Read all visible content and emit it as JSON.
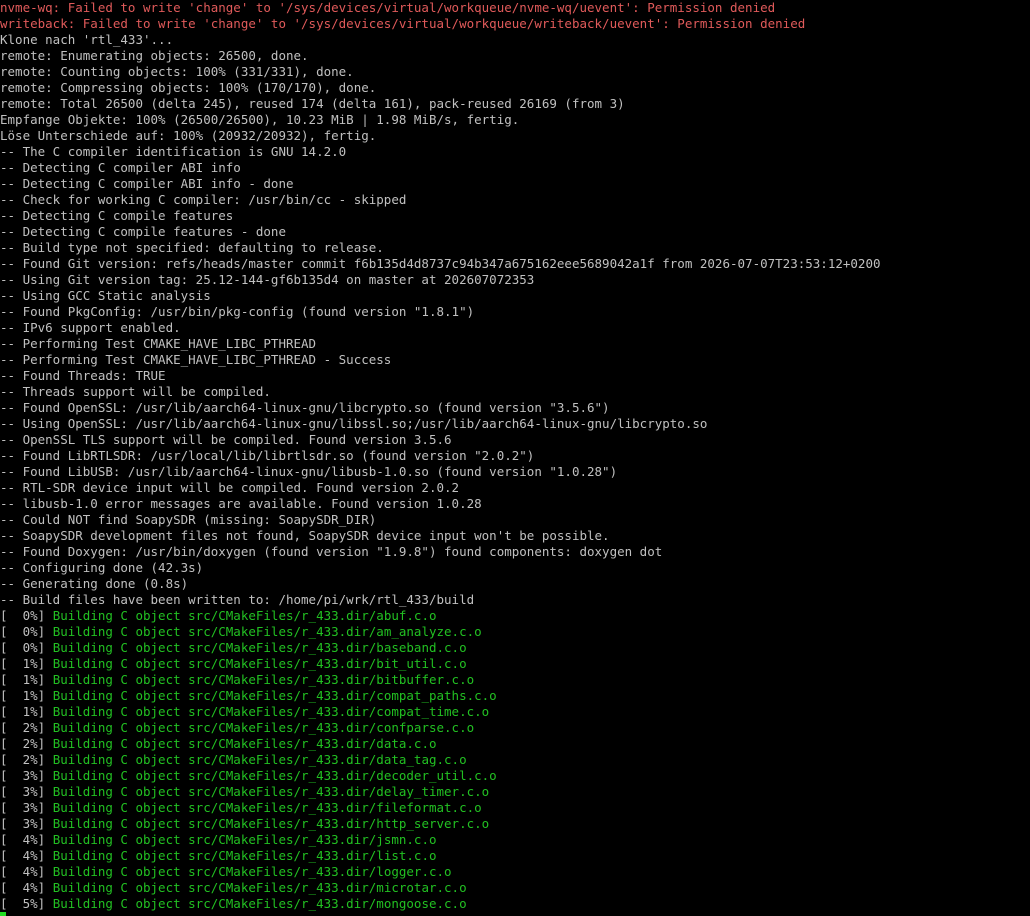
{
  "terminal": {
    "colors": {
      "background": "#000000",
      "foreground": "#c0c0c0",
      "error": "#e05a5a",
      "progress": "#22c022",
      "cursor": "#22dd22"
    },
    "lines": [
      {
        "type": "error",
        "text": "nvme-wq: Failed to write 'change' to '/sys/devices/virtual/workqueue/nvme-wq/uevent': Permission denied"
      },
      {
        "type": "error",
        "text": "writeback: Failed to write 'change' to '/sys/devices/virtual/workqueue/writeback/uevent': Permission denied"
      },
      {
        "type": "normal",
        "text": "Klone nach 'rtl_433'..."
      },
      {
        "type": "normal",
        "text": "remote: Enumerating objects: 26500, done."
      },
      {
        "type": "normal",
        "text": "remote: Counting objects: 100% (331/331), done."
      },
      {
        "type": "normal",
        "text": "remote: Compressing objects: 100% (170/170), done."
      },
      {
        "type": "normal",
        "text": "remote: Total 26500 (delta 245), reused 174 (delta 161), pack-reused 26169 (from 3)"
      },
      {
        "type": "normal",
        "text": "Empfange Objekte: 100% (26500/26500), 10.23 MiB | 1.98 MiB/s, fertig."
      },
      {
        "type": "normal",
        "text": "Löse Unterschiede auf: 100% (20932/20932), fertig."
      },
      {
        "type": "normal",
        "text": "-- The C compiler identification is GNU 14.2.0"
      },
      {
        "type": "normal",
        "text": "-- Detecting C compiler ABI info"
      },
      {
        "type": "normal",
        "text": "-- Detecting C compiler ABI info - done"
      },
      {
        "type": "normal",
        "text": "-- Check for working C compiler: /usr/bin/cc - skipped"
      },
      {
        "type": "normal",
        "text": "-- Detecting C compile features"
      },
      {
        "type": "normal",
        "text": "-- Detecting C compile features - done"
      },
      {
        "type": "normal",
        "text": "-- Build type not specified: defaulting to release."
      },
      {
        "type": "normal",
        "text": "-- Found Git version: refs/heads/master commit f6b135d4d8737c94b347a675162eee5689042a1f from 2026-07-07T23:53:12+0200"
      },
      {
        "type": "normal",
        "text": "-- Using Git version tag: 25.12-144-gf6b135d4 on master at 202607072353"
      },
      {
        "type": "normal",
        "text": "-- Using GCC Static analysis"
      },
      {
        "type": "normal",
        "text": "-- Found PkgConfig: /usr/bin/pkg-config (found version \"1.8.1\")"
      },
      {
        "type": "normal",
        "text": "-- IPv6 support enabled."
      },
      {
        "type": "normal",
        "text": "-- Performing Test CMAKE_HAVE_LIBC_PTHREAD"
      },
      {
        "type": "normal",
        "text": "-- Performing Test CMAKE_HAVE_LIBC_PTHREAD - Success"
      },
      {
        "type": "normal",
        "text": "-- Found Threads: TRUE"
      },
      {
        "type": "normal",
        "text": "-- Threads support will be compiled."
      },
      {
        "type": "normal",
        "text": "-- Found OpenSSL: /usr/lib/aarch64-linux-gnu/libcrypto.so (found version \"3.5.6\")"
      },
      {
        "type": "normal",
        "text": "-- Using OpenSSL: /usr/lib/aarch64-linux-gnu/libssl.so;/usr/lib/aarch64-linux-gnu/libcrypto.so"
      },
      {
        "type": "normal",
        "text": "-- OpenSSL TLS support will be compiled. Found version 3.5.6"
      },
      {
        "type": "normal",
        "text": "-- Found LibRTLSDR: /usr/local/lib/librtlsdr.so (found version \"2.0.2\")"
      },
      {
        "type": "normal",
        "text": "-- Found LibUSB: /usr/lib/aarch64-linux-gnu/libusb-1.0.so (found version \"1.0.28\")"
      },
      {
        "type": "normal",
        "text": "-- RTL-SDR device input will be compiled. Found version 2.0.2"
      },
      {
        "type": "normal",
        "text": "-- libusb-1.0 error messages are available. Found version 1.0.28"
      },
      {
        "type": "normal",
        "text": "-- Could NOT find SoapySDR (missing: SoapySDR_DIR)"
      },
      {
        "type": "normal",
        "text": "-- SoapySDR development files not found, SoapySDR device input won't be possible."
      },
      {
        "type": "normal",
        "text": "-- Found Doxygen: /usr/bin/doxygen (found version \"1.9.8\") found components: doxygen dot"
      },
      {
        "type": "normal",
        "text": "-- Configuring done (42.3s)"
      },
      {
        "type": "normal",
        "text": "-- Generating done (0.8s)"
      },
      {
        "type": "normal",
        "text": "-- Build files have been written to: /home/pi/wrk/rtl_433/build"
      },
      {
        "type": "build",
        "pct": "[  0%] ",
        "text": "Building C object src/CMakeFiles/r_433.dir/abuf.c.o"
      },
      {
        "type": "build",
        "pct": "[  0%] ",
        "text": "Building C object src/CMakeFiles/r_433.dir/am_analyze.c.o"
      },
      {
        "type": "build",
        "pct": "[  0%] ",
        "text": "Building C object src/CMakeFiles/r_433.dir/baseband.c.o"
      },
      {
        "type": "build",
        "pct": "[  1%] ",
        "text": "Building C object src/CMakeFiles/r_433.dir/bit_util.c.o"
      },
      {
        "type": "build",
        "pct": "[  1%] ",
        "text": "Building C object src/CMakeFiles/r_433.dir/bitbuffer.c.o"
      },
      {
        "type": "build",
        "pct": "[  1%] ",
        "text": "Building C object src/CMakeFiles/r_433.dir/compat_paths.c.o"
      },
      {
        "type": "build",
        "pct": "[  1%] ",
        "text": "Building C object src/CMakeFiles/r_433.dir/compat_time.c.o"
      },
      {
        "type": "build",
        "pct": "[  2%] ",
        "text": "Building C object src/CMakeFiles/r_433.dir/confparse.c.o"
      },
      {
        "type": "build",
        "pct": "[  2%] ",
        "text": "Building C object src/CMakeFiles/r_433.dir/data.c.o"
      },
      {
        "type": "build",
        "pct": "[  2%] ",
        "text": "Building C object src/CMakeFiles/r_433.dir/data_tag.c.o"
      },
      {
        "type": "build",
        "pct": "[  3%] ",
        "text": "Building C object src/CMakeFiles/r_433.dir/decoder_util.c.o"
      },
      {
        "type": "build",
        "pct": "[  3%] ",
        "text": "Building C object src/CMakeFiles/r_433.dir/delay_timer.c.o"
      },
      {
        "type": "build",
        "pct": "[  3%] ",
        "text": "Building C object src/CMakeFiles/r_433.dir/fileformat.c.o"
      },
      {
        "type": "build",
        "pct": "[  3%] ",
        "text": "Building C object src/CMakeFiles/r_433.dir/http_server.c.o"
      },
      {
        "type": "build",
        "pct": "[  4%] ",
        "text": "Building C object src/CMakeFiles/r_433.dir/jsmn.c.o"
      },
      {
        "type": "build",
        "pct": "[  4%] ",
        "text": "Building C object src/CMakeFiles/r_433.dir/list.c.o"
      },
      {
        "type": "build",
        "pct": "[  4%] ",
        "text": "Building C object src/CMakeFiles/r_433.dir/logger.c.o"
      },
      {
        "type": "build",
        "pct": "[  4%] ",
        "text": "Building C object src/CMakeFiles/r_433.dir/microtar.c.o"
      },
      {
        "type": "build",
        "pct": "[  5%] ",
        "text": "Building C object src/CMakeFiles/r_433.dir/mongoose.c.o"
      }
    ]
  }
}
